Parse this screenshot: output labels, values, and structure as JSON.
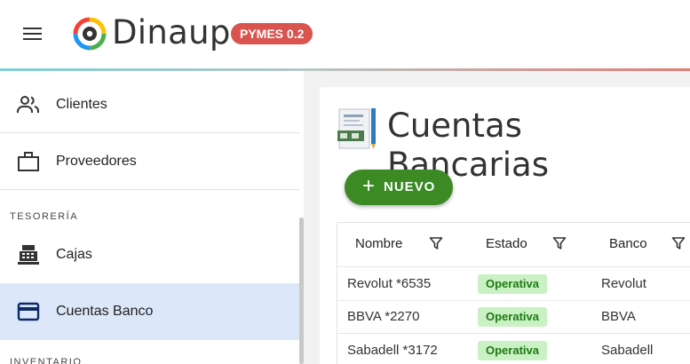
{
  "header": {
    "brand": "Dinaup",
    "badge": "PYMES 0.2"
  },
  "sidebar": {
    "items": [
      {
        "label": "Clientes",
        "icon": "people-icon"
      },
      {
        "label": "Proveedores",
        "icon": "briefcase-icon"
      },
      {
        "label": "Cajas",
        "icon": "cash-register-icon"
      },
      {
        "label": "Cuentas Banco",
        "icon": "credit-card-icon",
        "active": true
      }
    ],
    "sections": {
      "tesoreria": "TESORERÍA",
      "inventario": "INVENTARIO"
    }
  },
  "main": {
    "title": "Cuentas Bancarias",
    "new_button": "NUEVO",
    "table": {
      "columns": [
        "Nombre",
        "Estado",
        "Banco"
      ],
      "rows": [
        {
          "nombre": "Revolut *6535",
          "estado": "Operativa",
          "banco": "Revolut"
        },
        {
          "nombre": "BBVA *2270",
          "estado": "Operativa",
          "banco": "BBVA"
        },
        {
          "nombre": "Sabadell *3172",
          "estado": "Operativa",
          "banco": "Sabadell"
        }
      ]
    }
  },
  "colors": {
    "accent": "#3b8a24",
    "badge": "#d9534f",
    "active_item": "#dce7fa",
    "status_bg": "#c9f1c3",
    "status_text": "#1f7a15"
  }
}
